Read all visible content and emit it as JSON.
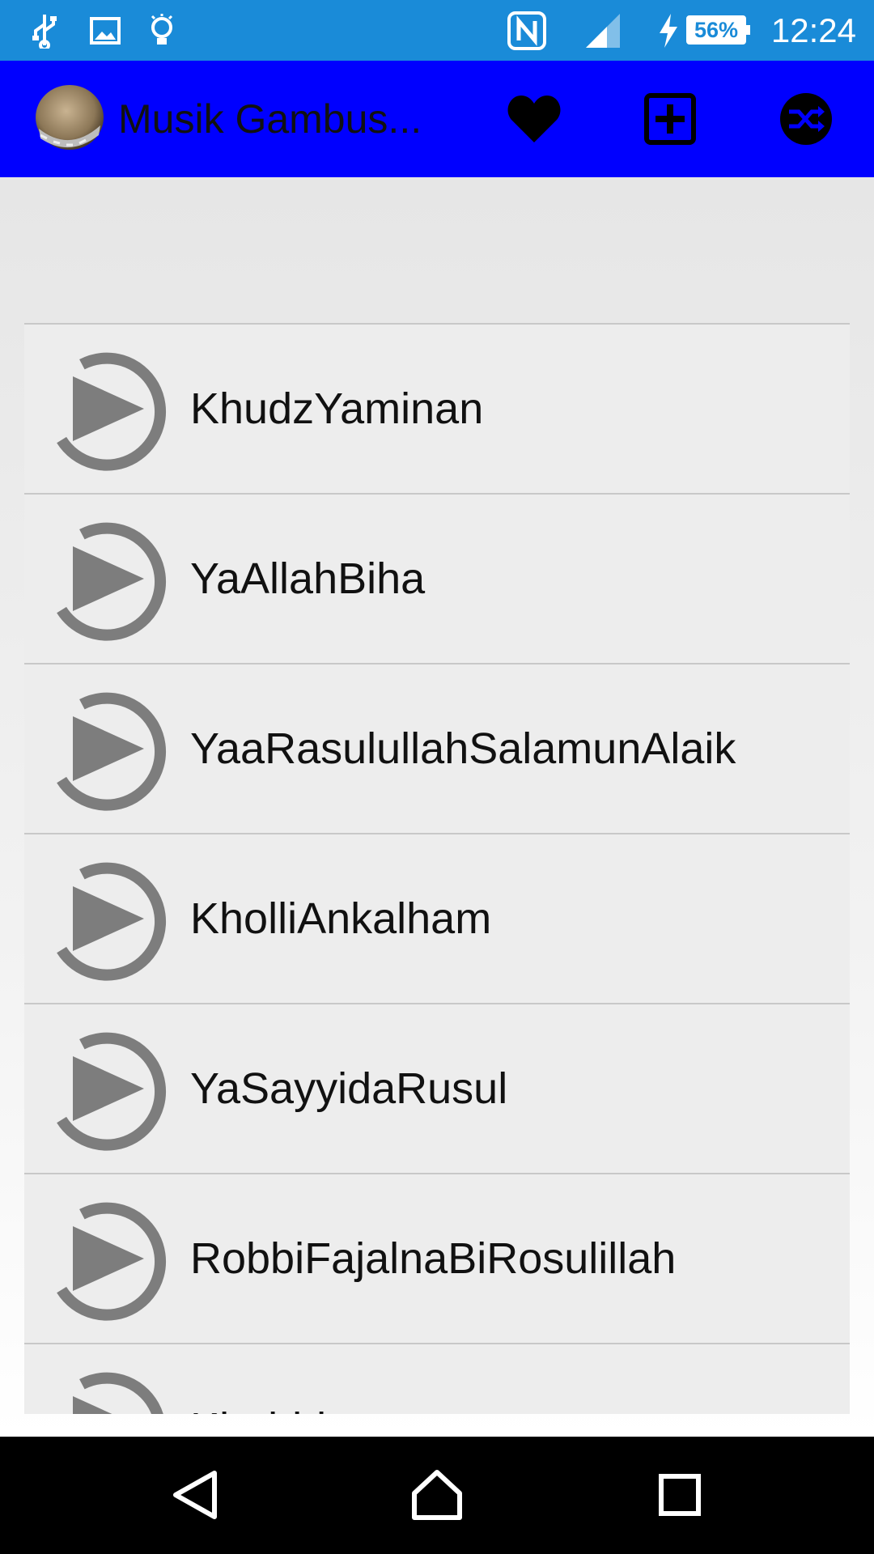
{
  "status_bar": {
    "time": "12:24",
    "battery_percent": "56%",
    "icons": [
      "usb-icon",
      "image-icon",
      "bulb-icon",
      "nfc-icon",
      "signal-icon",
      "charging-icon"
    ]
  },
  "app_bar": {
    "title": "Musik Gambus...",
    "logo": "gambus-drum-logo",
    "actions": [
      "heart-icon",
      "add-box-icon",
      "shuffle-icon"
    ],
    "color": "#0000ff"
  },
  "playlist": {
    "items": [
      {
        "label": "KhudzYaminan"
      },
      {
        "label": "YaAllahBiha"
      },
      {
        "label": "YaaRasulullahSalamunAlaik"
      },
      {
        "label": "KholliAnkalham"
      },
      {
        "label": "YaSayyidaRusul"
      },
      {
        "label": "RobbiFajalnaBiRosulillah"
      },
      {
        "label": "Khobbi..."
      }
    ]
  },
  "nav_bar": {
    "buttons": [
      "back-icon",
      "home-icon",
      "recents-icon"
    ]
  },
  "colors": {
    "status_bar": "#1a8bd8",
    "app_bar": "#0000ff",
    "row_background": "#ededed",
    "play_icon": "#7d7d7d"
  }
}
